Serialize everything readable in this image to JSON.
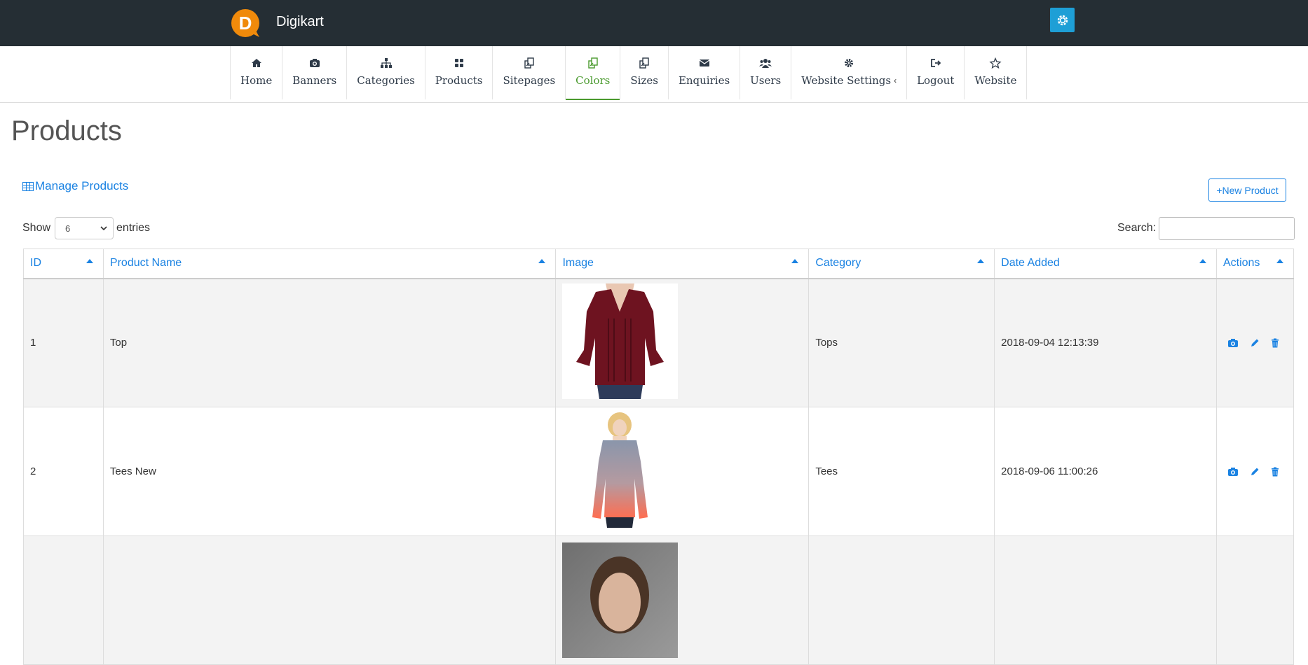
{
  "header": {
    "brand": "Digikart",
    "logo_letter": "D"
  },
  "nav": [
    {
      "icon": "home-icon",
      "label": "Home"
    },
    {
      "icon": "camera-icon",
      "label": "Banners"
    },
    {
      "icon": "sitemap-icon",
      "label": "Categories"
    },
    {
      "icon": "grid-icon",
      "label": "Products"
    },
    {
      "icon": "copy-icon",
      "label": "Sitepages"
    },
    {
      "icon": "copy-icon",
      "label": "Colors",
      "active": true
    },
    {
      "icon": "copy-icon",
      "label": "Sizes"
    },
    {
      "icon": "envelope-icon",
      "label": "Enquiries"
    },
    {
      "icon": "users-icon",
      "label": "Users"
    },
    {
      "icon": "gear-icon",
      "label": "Website Settings",
      "caret": "‹"
    },
    {
      "icon": "logout-icon",
      "label": "Logout"
    },
    {
      "icon": "star-icon",
      "label": "Website"
    }
  ],
  "page": {
    "title": "Products"
  },
  "panel": {
    "manage_label": "Manage Products",
    "new_button": "+New Product",
    "show_label": "Show",
    "entries_label": "entries",
    "page_size": "6",
    "search_label": "Search:"
  },
  "table": {
    "columns": [
      "ID",
      "Product Name",
      "Image",
      "Category",
      "Date Added",
      "Actions"
    ],
    "rows": [
      {
        "id": "1",
        "name": "Top",
        "image": "maroon blouse",
        "category": "Tops",
        "date": "2018-09-04 12:13:39"
      },
      {
        "id": "2",
        "name": "Tees New",
        "image": "gradient long-sleeve tee",
        "category": "Tees",
        "date": "2018-09-06 11:00:26"
      },
      {
        "id": "",
        "name": "",
        "image": "portrait",
        "category": "",
        "date": ""
      }
    ]
  },
  "colors": {
    "topbar": "#252e34",
    "accent": "#1a82e2",
    "active_nav": "#4a9a2e",
    "gear_button": "#1e9fd6"
  }
}
